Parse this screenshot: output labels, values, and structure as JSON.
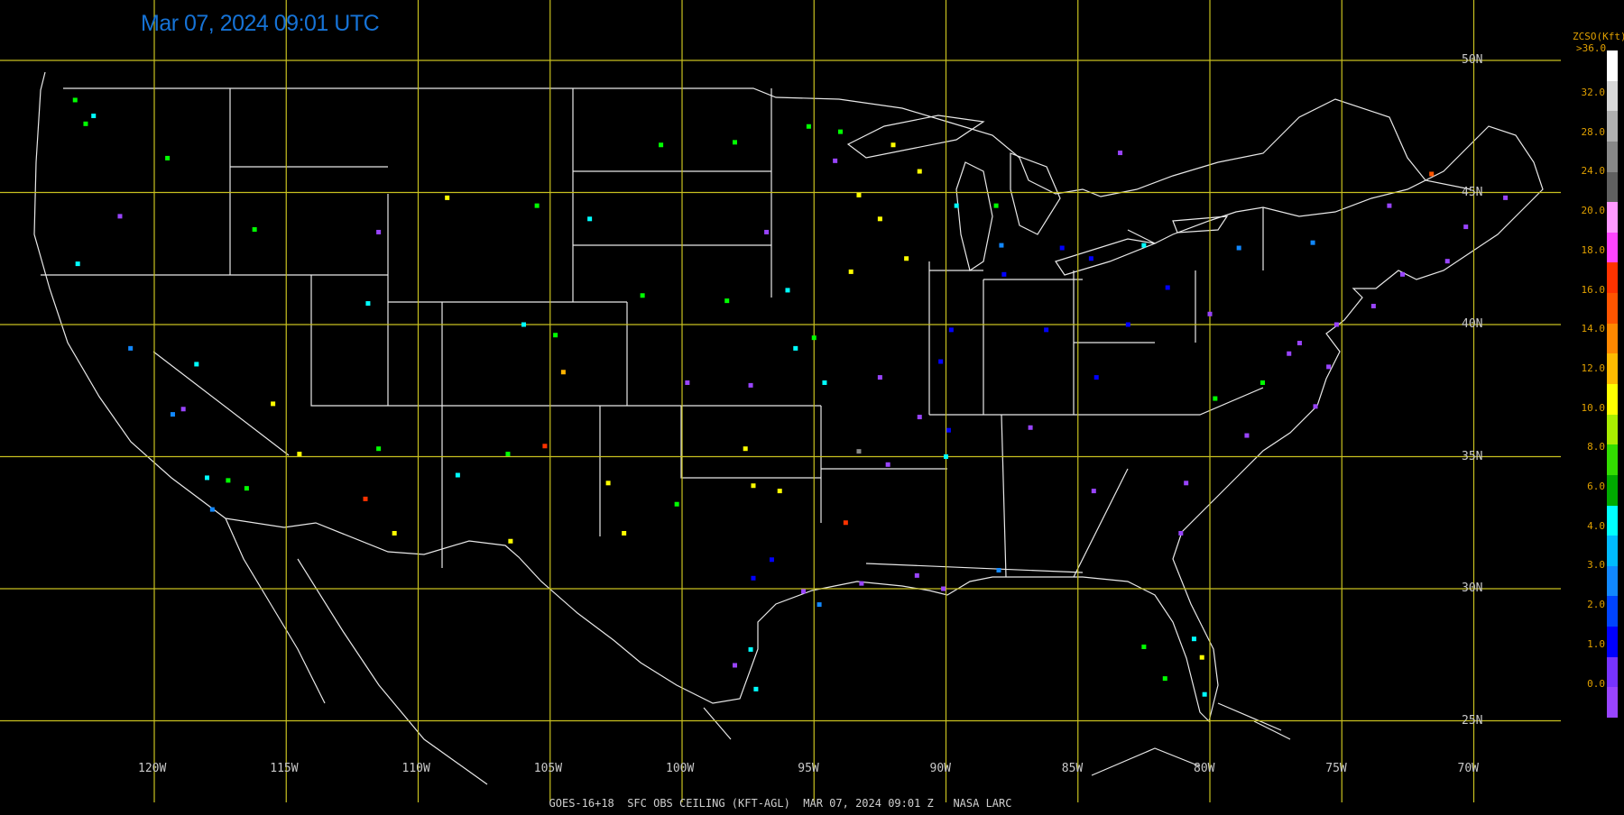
{
  "timestamp": "Mar 07, 2024 09:01 UTC",
  "footer": "GOES-16+18  SFC OBS CEILING (KFT-AGL)  MAR 07, 2024 09:01 Z   NASA LARC",
  "grid": {
    "latitudes": [
      {
        "deg": 50,
        "label": "50N"
      },
      {
        "deg": 45,
        "label": "45N"
      },
      {
        "deg": 40,
        "label": "40N"
      },
      {
        "deg": 35,
        "label": "35N"
      },
      {
        "deg": 30,
        "label": "30N"
      },
      {
        "deg": 25,
        "label": "25N"
      }
    ],
    "longitudes": [
      {
        "deg": -120,
        "label": "120W"
      },
      {
        "deg": -115,
        "label": "115W"
      },
      {
        "deg": -110,
        "label": "110W"
      },
      {
        "deg": -105,
        "label": "105W"
      },
      {
        "deg": -100,
        "label": "100W"
      },
      {
        "deg": -95,
        "label": "95W"
      },
      {
        "deg": -90,
        "label": "90W"
      },
      {
        "deg": -85,
        "label": "85W"
      },
      {
        "deg": -80,
        "label": "80W"
      },
      {
        "deg": -75,
        "label": "75W"
      },
      {
        "deg": -70,
        "label": "70W"
      }
    ]
  },
  "legend": {
    "title": "ZCSO(Kft)",
    "top_label": ">36.0",
    "ticks": [
      "32.0",
      "28.0",
      "24.0",
      "20.0",
      "18.0",
      "16.0",
      "14.0",
      "12.0",
      "10.0",
      "8.0",
      "6.0",
      "4.0",
      "3.0",
      "2.0",
      "1.0",
      "0.0"
    ],
    "colors": [
      "#ffffff",
      "#d8d8d8",
      "#b0b0b0",
      "#888888",
      "#606060",
      "#ff99ff",
      "#ff44ff",
      "#ff3300",
      "#ff5500",
      "#ff8800",
      "#ffbb00",
      "#ffff00",
      "#aaee00",
      "#33dd00",
      "#00aa00",
      "#00ffff",
      "#00bbff",
      "#1188ff",
      "#0044ff",
      "#0000ff",
      "#7733ff",
      "#9944ff"
    ],
    "highlight": {
      "text": "#e0a000"
    }
  },
  "colors": {
    "lines": "#e8e8e8",
    "grid": "#c8c020",
    "background": "#000000"
  },
  "stations": [
    [
      "#00ff00",
      -123.0,
      48.5
    ],
    [
      "#00ff00",
      -122.6,
      47.6
    ],
    [
      "#00ffff",
      -122.3,
      47.9
    ],
    [
      "#00ff00",
      -119.5,
      46.3
    ],
    [
      "#00ffff",
      -122.9,
      42.3
    ],
    [
      "#9944ff",
      -121.3,
      44.1
    ],
    [
      "#1188ff",
      -120.9,
      39.1
    ],
    [
      "#00ffff",
      -118.0,
      34.2
    ],
    [
      "#00ff00",
      -117.2,
      34.1
    ],
    [
      "#00ff00",
      -116.5,
      33.8
    ],
    [
      "#1188ff",
      -117.8,
      33.0
    ],
    [
      "#ffff00",
      -115.5,
      37.0
    ],
    [
      "#1188ff",
      -119.3,
      36.6
    ],
    [
      "#00ff00",
      -116.2,
      43.6
    ],
    [
      "#00ffff",
      -111.9,
      40.8
    ],
    [
      "#9944ff",
      -111.5,
      43.5
    ],
    [
      "#ffff00",
      -108.9,
      44.8
    ],
    [
      "#00ff00",
      -105.5,
      44.5
    ],
    [
      "#00ffff",
      -106.0,
      40.0
    ],
    [
      "#00ff00",
      -104.8,
      39.6
    ],
    [
      "#ffb300",
      -104.5,
      38.2
    ],
    [
      "#ffff00",
      -102.2,
      32.1
    ],
    [
      "#ffff00",
      -102.8,
      34.0
    ],
    [
      "#00ff00",
      -100.2,
      33.2
    ],
    [
      "#ffff00",
      -97.6,
      35.3
    ],
    [
      "#ffff00",
      -97.3,
      33.9
    ],
    [
      "#ffff00",
      -96.3,
      33.7
    ],
    [
      "#0000ff",
      -96.6,
      31.1
    ],
    [
      "#0000ff",
      -97.3,
      30.4
    ],
    [
      "#9944ff",
      -95.4,
      29.9
    ],
    [
      "#9944ff",
      -98.0,
      27.1
    ],
    [
      "#00ffff",
      -97.2,
      26.2
    ],
    [
      "#1188ff",
      -94.8,
      29.4
    ],
    [
      "#00ffff",
      -97.4,
      27.7
    ],
    [
      "#ffff00",
      -93.3,
      44.9
    ],
    [
      "#ffff00",
      -92.5,
      44.0
    ],
    [
      "#ffff00",
      -91.0,
      45.8
    ],
    [
      "#00ff00",
      -95.2,
      47.5
    ],
    [
      "#9944ff",
      -94.2,
      46.2
    ],
    [
      "#ffff00",
      -93.6,
      42.0
    ],
    [
      "#ffff00",
      -91.5,
      42.5
    ],
    [
      "#00ffff",
      -96.0,
      41.3
    ],
    [
      "#00ff00",
      -95.0,
      39.5
    ],
    [
      "#00ffff",
      -94.6,
      37.8
    ],
    [
      "#9944ff",
      -92.5,
      38.0
    ],
    [
      "#0000ff",
      -90.2,
      38.6
    ],
    [
      "#9944ff",
      -91.0,
      36.5
    ],
    [
      "#0000ff",
      -89.8,
      39.8
    ],
    [
      "#0000ff",
      -87.8,
      41.9
    ],
    [
      "#0000ff",
      -86.2,
      39.8
    ],
    [
      "#0000ff",
      -84.5,
      42.5
    ],
    [
      "#0000ff",
      -83.1,
      40.0
    ],
    [
      "#0000ff",
      -84.3,
      38.0
    ],
    [
      "#9944ff",
      -86.8,
      36.1
    ],
    [
      "#9944ff",
      -84.4,
      33.7
    ],
    [
      "#9944ff",
      -81.1,
      32.1
    ],
    [
      "#9944ff",
      -80.9,
      34.0
    ],
    [
      "#9944ff",
      -78.6,
      35.8
    ],
    [
      "#9944ff",
      -77.0,
      38.9
    ],
    [
      "#00ff00",
      -78.0,
      37.8
    ],
    [
      "#00ff00",
      -79.8,
      37.2
    ],
    [
      "#9944ff",
      -80.0,
      40.4
    ],
    [
      "#9944ff",
      -76.6,
      39.3
    ],
    [
      "#9944ff",
      -75.2,
      40.0
    ],
    [
      "#9944ff",
      -73.8,
      40.7
    ],
    [
      "#9944ff",
      -71.0,
      42.4
    ],
    [
      "#9944ff",
      -72.7,
      41.9
    ],
    [
      "#9944ff",
      -70.3,
      43.7
    ],
    [
      "#9944ff",
      -68.8,
      44.8
    ],
    [
      "#1188ff",
      -76.1,
      43.1
    ],
    [
      "#1188ff",
      -78.9,
      42.9
    ],
    [
      "#0000ff",
      -81.6,
      41.4
    ],
    [
      "#00ffff",
      -82.5,
      43.0
    ],
    [
      "#9944ff",
      -73.2,
      44.5
    ],
    [
      "#ff5500",
      -71.6,
      45.7
    ],
    [
      "#9944ff",
      -75.5,
      38.4
    ],
    [
      "#9944ff",
      -76.0,
      36.9
    ],
    [
      "#00ffff",
      -80.2,
      26.0
    ],
    [
      "#00ff00",
      -81.7,
      26.6
    ],
    [
      "#00ffff",
      -80.6,
      28.1
    ],
    [
      "#ffff00",
      -80.3,
      27.4
    ],
    [
      "#00ff00",
      -82.5,
      27.8
    ],
    [
      "#9944ff",
      -90.1,
      30.0
    ],
    [
      "#9944ff",
      -91.1,
      30.5
    ],
    [
      "#9944ff",
      -93.2,
      30.2
    ],
    [
      "#1188ff",
      -88.0,
      30.7
    ],
    [
      "#ff3300",
      -93.8,
      32.5
    ],
    [
      "#9944ff",
      -92.2,
      34.7
    ],
    [
      "#888888",
      -93.3,
      35.2
    ],
    [
      "#00ffff",
      -90.0,
      35.0
    ],
    [
      "#0000ff",
      -89.9,
      36.0
    ],
    [
      "#ff3300",
      -105.2,
      35.4
    ],
    [
      "#ff3300",
      -112.0,
      33.4
    ],
    [
      "#ffff00",
      -114.5,
      35.1
    ],
    [
      "#00ff00",
      -111.5,
      35.3
    ],
    [
      "#ffff00",
      -110.9,
      32.1
    ],
    [
      "#00ff00",
      -106.6,
      35.1
    ],
    [
      "#ffff00",
      -106.5,
      31.8
    ],
    [
      "#00ffff",
      -108.5,
      34.3
    ],
    [
      "#00ffff",
      -118.4,
      38.5
    ],
    [
      "#9944ff",
      -118.9,
      36.8
    ],
    [
      "#00ff00",
      -100.8,
      46.8
    ],
    [
      "#00ff00",
      -98.0,
      46.9
    ],
    [
      "#9944ff",
      -96.8,
      43.5
    ],
    [
      "#00ffff",
      -103.5,
      44.0
    ],
    [
      "#00ff00",
      -101.5,
      41.1
    ],
    [
      "#00ff00",
      -98.3,
      40.9
    ],
    [
      "#9944ff",
      -97.4,
      37.7
    ],
    [
      "#9944ff",
      -99.8,
      37.8
    ],
    [
      "#00ffff",
      -95.7,
      39.1
    ],
    [
      "#00ff00",
      -94.0,
      47.3
    ],
    [
      "#ffff00",
      -92.0,
      46.8
    ],
    [
      "#00ffff",
      -89.6,
      44.5
    ],
    [
      "#00ff00",
      -88.1,
      44.5
    ],
    [
      "#9944ff",
      -83.4,
      46.5
    ],
    [
      "#0000ff",
      -85.6,
      42.9
    ],
    [
      "#1188ff",
      -87.9,
      43.0
    ]
  ]
}
